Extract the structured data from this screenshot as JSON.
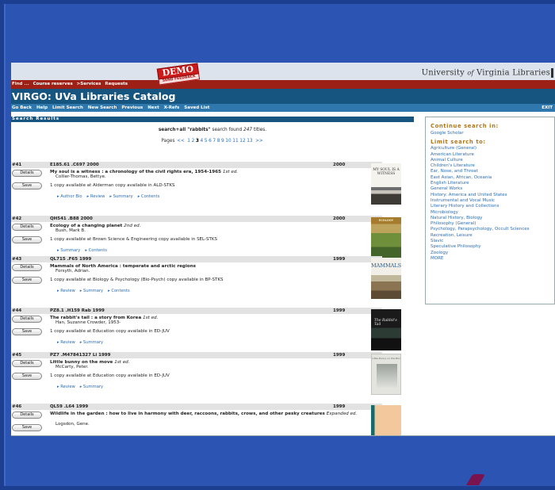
{
  "logo": {
    "line": [
      "University",
      "of",
      "Virginia Libraries"
    ]
  },
  "demo_badge": {
    "text": "DEMO",
    "sub": "SEND FEEDBACK"
  },
  "red_nav": {
    "items": [
      "Find ...",
      "Course reserves",
      ">Services",
      "Requests"
    ]
  },
  "app_title": "VIRGO: UVa Libraries Catalog",
  "actions": [
    "Go Back",
    "Help",
    "Limit Search",
    "New Search",
    "Previous",
    "Next",
    "X-Refs",
    "Saved List"
  ],
  "exit_label": "EXIT",
  "results_header": "Search Results",
  "summary": {
    "query": "search+all \"rabbits\"",
    "middle": " search found ",
    "count": "247",
    "suffix": " titles."
  },
  "pages": {
    "label": "Pages",
    "prev": "<<",
    "next": ">>",
    "items": [
      "1",
      "2",
      "3",
      "4",
      "5",
      "6",
      "7",
      "8",
      "9",
      "10",
      "11",
      "12",
      "13"
    ],
    "current": "3"
  },
  "buttons": {
    "details": "Details",
    "save": "Save"
  },
  "records": [
    {
      "num": "#41",
      "call": "E185.61 .C697 2000",
      "year": "2000",
      "title": "My soul is a witness : a chronology of the civil rights era, 1954-1965",
      "edition": "1st ed.",
      "author": "Collier-Thomas, Bettye.",
      "avail": "1 copy available at Alderman copy available in ALD-STKS",
      "links": [
        "Author Bio",
        "Review",
        "Summary",
        "Contents"
      ],
      "cover_text": "MY SOUL IS A WITNESS"
    },
    {
      "num": "#42",
      "call": "QH541 .B88 2000",
      "year": "2000",
      "title": "Ecology of a changing planet",
      "edition": "2nd ed.",
      "author": "Bush, Mark B.",
      "avail": "1 copy available at Brown Science & Engineering copy available in SEL-STKS",
      "links": [
        "Summary",
        "Contents"
      ],
      "cover_text": "ECOLOGY"
    },
    {
      "num": "#43",
      "call": "QL715 .F65 1999",
      "year": "1999",
      "title": "Mammals of North America : temperate and arctic regions",
      "edition": "",
      "author": "Forsyth, Adrian.",
      "avail": "1 copy available at Biology & Psychology (Bio-Psych) copy available in BP-STKS",
      "links": [
        "Review",
        "Summary",
        "Contents"
      ],
      "cover_text": "MAMMALS"
    },
    {
      "num": "#44",
      "call": "PZ8.1 .H159 Rab 1999",
      "year": "1999",
      "title": "The rabbit's tail : a story from Korea",
      "edition": "1st ed.",
      "author": "Han, Suzanne Crowder, 1953-",
      "avail": "1 copy available at Education copy available in ED-JUV",
      "links": [
        "Review",
        "Summary"
      ],
      "cover_text": "The Rabbit's Tail"
    },
    {
      "num": "#45",
      "call": "PZ7 .M47841327 Li 1999",
      "year": "1999",
      "title": "Little bunny on the move",
      "edition": "1st ed.",
      "author": "McCarty, Peter.",
      "avail": "1 copy available at Education copy available in ED-JUV",
      "links": [
        "Review",
        "Summary"
      ],
      "cover_text": "Little Bunny on the Move"
    },
    {
      "num": "#46",
      "call": "QL59 .L64 1999",
      "year": "1999",
      "title": "Wildlife in the garden : how to live in harmony with deer, raccoons, rabbits, crows, and other pesky creatures",
      "edition": "Expanded ed.",
      "author": "Logsdon, Gene.",
      "avail": "",
      "links": [],
      "cover_text": ""
    }
  ],
  "sidebar": {
    "continue_heading": "Continue search in:",
    "continue_links": [
      "Google Scholar"
    ],
    "limit_heading": "Limit search to:",
    "limit_links": [
      "Agriculture (General)",
      "American Literature",
      "Animal Culture",
      "Children's Literature",
      "Ear, Nose, and Throat",
      "East Asian, African, Oceania",
      "English Literature",
      "General Works",
      "History: America and United States",
      "Instrumental and Vocal Music",
      "Literary History and Collections",
      "Microbiology",
      "Natural History, Biology",
      "Philosophy (General)",
      "Psychology, Parapsychology, Occult Sciences",
      "Recreation, Leisure",
      "Slavic",
      "Speculative Philosophy",
      "Zoology",
      "MORE"
    ]
  },
  "colors": {
    "title_bar": "#165580",
    "red_nav": "#9c2015",
    "link": "#2a6db5",
    "heading": "#b07618",
    "background": "#1c3f91"
  }
}
